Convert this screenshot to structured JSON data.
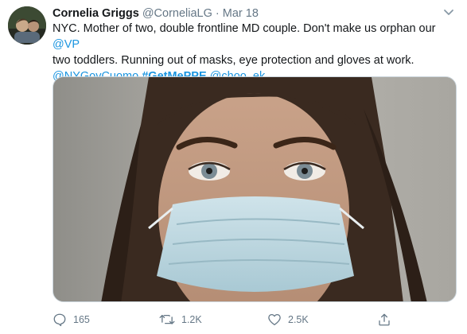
{
  "tweet": {
    "author_name": "Cornelia Griggs",
    "author_handle": "@CorneliaLG",
    "separator": "·",
    "date": "Mar 18",
    "text_line1": "NYC. Mother of two, double frontline MD couple. Don't make us orphan our",
    "text_line2": "two toddlers. Running out of masks, eye protection and gloves at work.",
    "mention_vp": "@VP",
    "mention_cuomo": "@NYGovCuomo",
    "hashtag": "#GetMePPE",
    "mention_choo": "@choo_ek"
  },
  "media": {
    "description": "Photo of a woman wearing a surgical mask"
  },
  "actions": {
    "reply_count": "165",
    "retweet_count": "1.2K",
    "like_count": "2.5K",
    "reply_icon": "reply-icon",
    "retweet_icon": "retweet-icon",
    "like_icon": "heart-icon",
    "share_icon": "share-icon"
  },
  "colors": {
    "link": "#1b95e0",
    "muted": "#657786",
    "text": "#14171a"
  }
}
